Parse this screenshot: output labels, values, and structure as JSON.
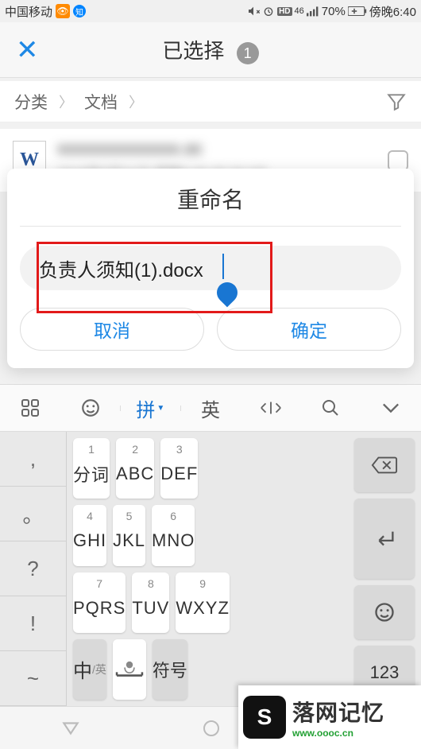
{
  "status": {
    "carrier": "中国移动",
    "battery_pct": "70%",
    "time": "傍晚6:40",
    "hd": "HD",
    "net": "46"
  },
  "header": {
    "title": "已选择",
    "count": "1"
  },
  "breadcrumb": {
    "a": "分类",
    "b": "文档"
  },
  "file": {
    "name_blur": "xxxxxxxxxxxxxx.oc",
    "meta_blur": "2018年5月31日 傍晚6:39 35.00 KB",
    "icon_letter": "W"
  },
  "dialog": {
    "title": "重命名",
    "input_value": "负责人须知(1).docx",
    "cancel": "取消",
    "confirm": "确定"
  },
  "kbd_toolbar": {
    "items": [
      "",
      "☺",
      "拼",
      "英",
      "",
      "",
      ""
    ]
  },
  "kbd": {
    "side": [
      ",",
      "。",
      "?",
      "!",
      "~"
    ],
    "keys": [
      {
        "num": "1",
        "main": "分词"
      },
      {
        "num": "2",
        "main": "ABC"
      },
      {
        "num": "3",
        "main": "DEF"
      },
      {
        "num": "4",
        "main": "GHI"
      },
      {
        "num": "5",
        "main": "JKL"
      },
      {
        "num": "6",
        "main": "MNO"
      },
      {
        "num": "7",
        "main": "PQRS"
      },
      {
        "num": "8",
        "main": "TUV"
      },
      {
        "num": "9",
        "main": "WXYZ"
      }
    ],
    "bottom": {
      "lang": "中",
      "lang_sub": "/英",
      "sym": "符号",
      "num": "123"
    }
  },
  "watermark": {
    "cn": "落网记忆",
    "en": "www.oooc.cn"
  }
}
